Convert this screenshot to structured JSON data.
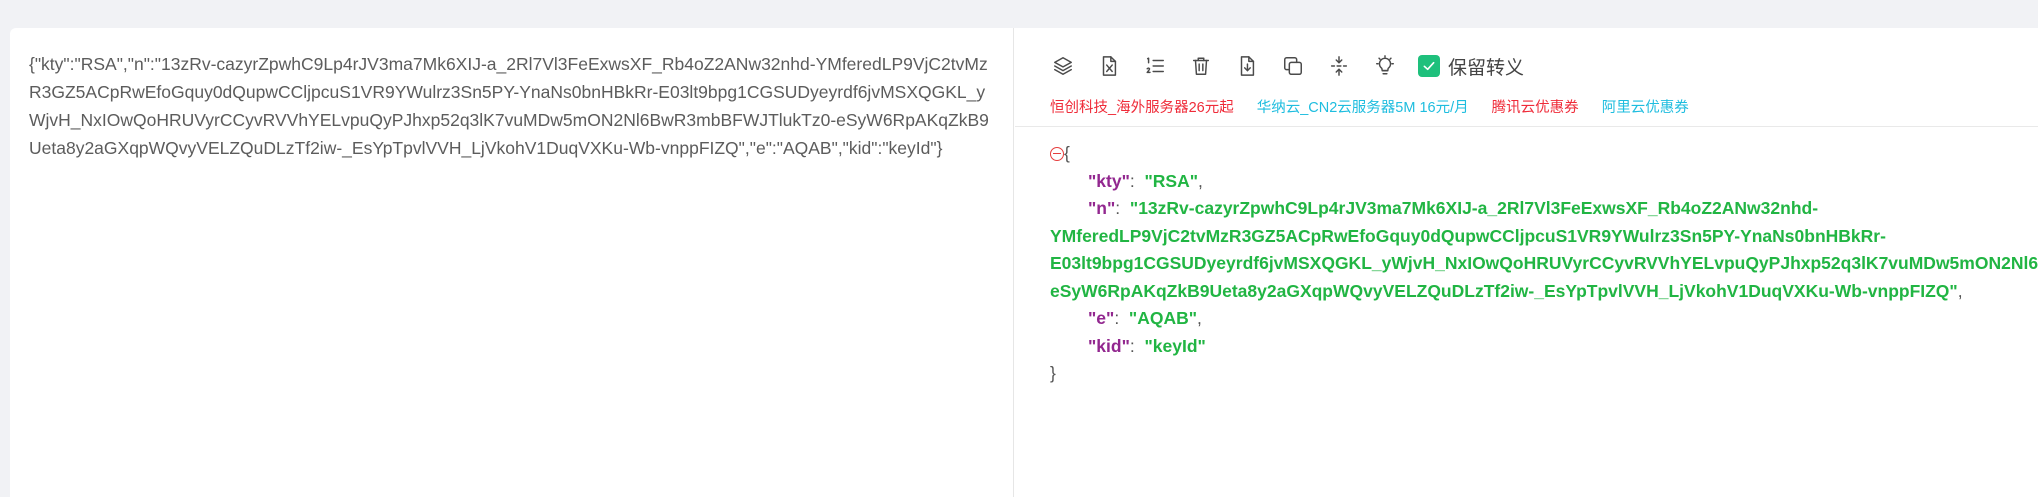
{
  "input": {
    "raw_json": "{\"kty\":\"RSA\",\"n\":\"13zRv-cazyrZpwhC9Lp4rJV3ma7Mk6XIJ-a_2Rl7Vl3FeExwsXF_Rb4oZ2ANw32nhd-YMferedLP9VjC2tvMzR3GZ5ACpRwEfoGquy0dQupwCCljpcuS1VR9YWulrz3Sn5PY-YnaNs0bnHBkRr-E03lt9bpg1CGSUDyeyrdf6jvMSXQGKL_yWjvH_NxIOwQoHRUVyrCCyvRVVhYELvpuQyPJhxp52q3lK7vuMDw5mON2Nl6BwR3mbBFWJTlukTz0-eSyW6RpAKqZkB9Ueta8y2aGXqpWQvyVELZQuDLzTf2iw-_EsYpTpvlVVH_LjVkohV1DuqVXKu-Wb-vnppFIZQ\",\"e\":\"AQAB\",\"kid\":\"keyId\"}"
  },
  "toolbar": {
    "buttons": [
      {
        "name": "compress-button",
        "icon": "layers-icon"
      },
      {
        "name": "excel-button",
        "icon": "file-x-icon"
      },
      {
        "name": "line-numbers-button",
        "icon": "ordered-list-icon"
      },
      {
        "name": "clear-button",
        "icon": "trash-icon"
      },
      {
        "name": "download-button",
        "icon": "file-download-icon"
      },
      {
        "name": "copy-button",
        "icon": "copy-icon"
      },
      {
        "name": "collapse-button",
        "icon": "compress-vertical-icon"
      },
      {
        "name": "theme-button",
        "icon": "bulb-icon"
      }
    ],
    "keep_escape_label": "保留转义",
    "keep_escape_checked": true
  },
  "ads": [
    {
      "text": "恒创科技_海外服务器26元起",
      "color": "#ef2b39"
    },
    {
      "text": "华纳云_CN2云服务器5M 16元/月",
      "color": "#1ebddf"
    },
    {
      "text": "腾讯云优惠券",
      "color": "#ef2b39"
    },
    {
      "text": "阿里云优惠券",
      "color": "#1ebddf"
    }
  ],
  "formatted": {
    "open_brace": "{",
    "close_brace": "}",
    "entries": [
      {
        "key": "\"kty\"",
        "value": "\"RSA\""
      },
      {
        "key": "\"n\"",
        "value": "\"13zRv-cazyrZpwhC9Lp4rJV3ma7Mk6XIJ-a_2Rl7Vl3FeExwsXF_Rb4oZ2ANw32nhd-YMferedLP9VjC2tvMzR3GZ5ACpRwEfoGquy0dQupwCCljpcuS1VR9YWulrz3Sn5PY-YnaNs0bnHBkRr-E03lt9bpg1CGSUDyeyrdf6jvMSXQGKL_yWjvH_NxIOwQoHRUVyrCCyvRVVhYELvpuQyPJhxp52q3lK7vuMDw5mON2Nl6BwR3mbBFWJTlukTz0-eSyW6RpAKqZkB9Ueta8y2aGXqpWQvyVELZQuDLzTf2iw-_EsYpTpvlVVH_LjVkohV1DuqVXKu-Wb-vnppFIZQ\""
      },
      {
        "key": "\"e\"",
        "value": "\"AQAB\""
      },
      {
        "key": "\"kid\"",
        "value": "\"keyId\""
      }
    ]
  },
  "colors": {
    "key": "#92278f",
    "string": "#21b543",
    "accent": "#1ec07c"
  }
}
